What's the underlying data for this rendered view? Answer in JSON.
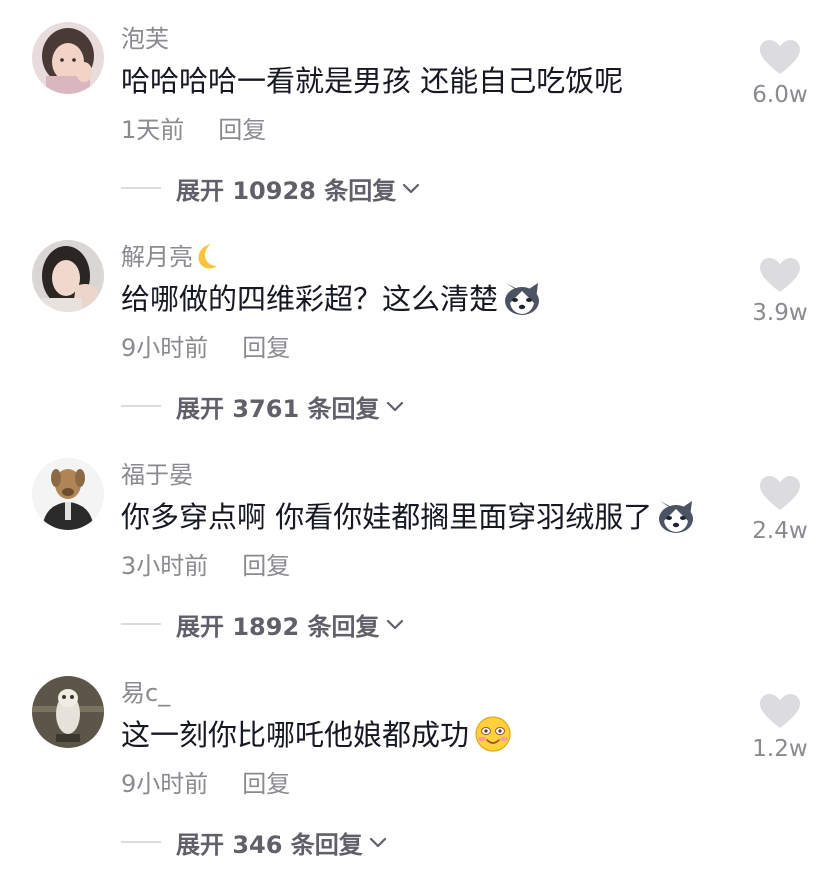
{
  "comments": [
    {
      "username": "泡芙",
      "text": "哈哈哈哈一看就是男孩 还能自己吃饭呢",
      "time": "1天前",
      "reply": "回复",
      "expand": "展开 10928 条回复",
      "likes": "6.0w",
      "avatar_icon": "avatar-girl-photo",
      "colors": {
        "bg": "#e9dcdc",
        "skin": "#f2d4c6",
        "hair": "#4a3a36"
      }
    },
    {
      "username": "解月亮",
      "username_icon": "crescent-moon-icon",
      "text": "给哪做的四维彩超？这么清楚",
      "text_emoji": "husky-dog-emoji",
      "time": "9小时前",
      "reply": "回复",
      "expand": "展开 3761 条回复",
      "likes": "3.9w",
      "avatar_icon": "avatar-girl-photo",
      "colors": {
        "bg": "#d9d6d4",
        "skin": "#f0d8cc",
        "hair": "#2b2624"
      }
    },
    {
      "username": "福于晏",
      "text": "你多穿点啊 你看你娃都搁里面穿羽绒服了",
      "text_emoji": "husky-dog-emoji",
      "time": "3小时前",
      "reply": "回复",
      "expand": "展开 1892 条回复",
      "likes": "2.4w",
      "avatar_icon": "avatar-dog-in-suit",
      "colors": {
        "bg": "#f4f4f4",
        "skin": "#b08656",
        "hair": "#2a2a2a"
      }
    },
    {
      "username": "易c_",
      "text": "这一刻你比哪吒他娘都成功",
      "text_emoji": "blushing-smile-emoji",
      "time": "9小时前",
      "reply": "回复",
      "expand": "展开 346 条回复",
      "likes": "1.2w",
      "avatar_icon": "avatar-owl-statue",
      "colors": {
        "bg": "#5b5648",
        "skin": "#e6e2da",
        "hair": "#3a372e"
      }
    }
  ],
  "colors": {
    "username": "#8a8a8f",
    "text": "#161823",
    "meta": "#8a8a8f",
    "expand": "#60606a",
    "heart": "#dcdcdf"
  }
}
